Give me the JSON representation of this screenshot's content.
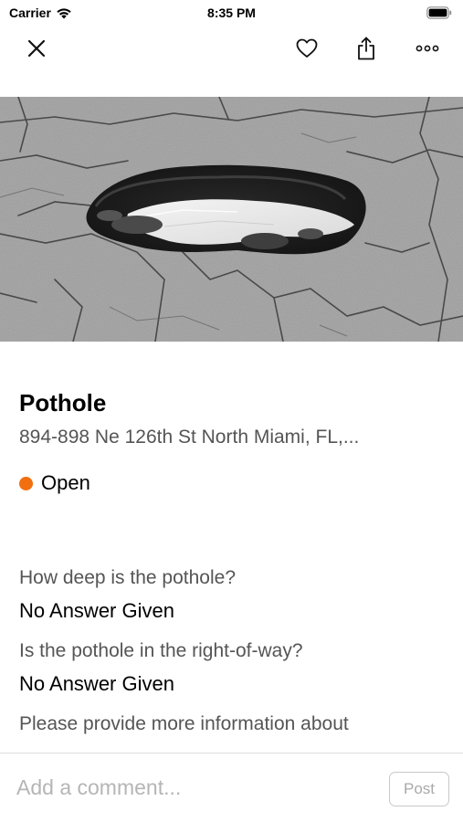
{
  "status_bar": {
    "carrier": "Carrier",
    "time": "8:35 PM"
  },
  "nav": {
    "icons": [
      "close-icon",
      "heart-icon",
      "share-icon",
      "more-icon"
    ]
  },
  "hero": {
    "subject": "pothole photo"
  },
  "request": {
    "title": "Pothole",
    "address": "894-898 Ne 126th St North Miami, FL,...",
    "status": "Open",
    "status_color": "#f26f10"
  },
  "questions": [
    {
      "q": "How deep is the pothole?",
      "a": "No Answer Given"
    },
    {
      "q": "Is the pothole in the right-of-way?",
      "a": "No Answer Given"
    },
    {
      "q": "Please provide more information about",
      "a": ""
    }
  ],
  "comment": {
    "placeholder": "Add a comment...",
    "post_label": "Post"
  }
}
